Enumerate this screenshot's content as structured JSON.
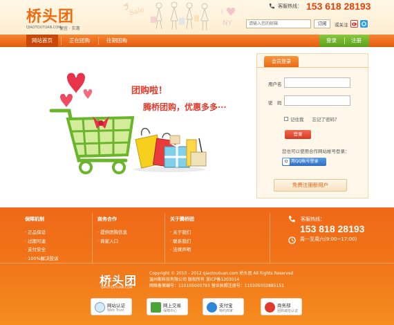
{
  "header": {
    "logo_text": "桥头团",
    "logo_domain": "QIAOTOUTUAN.COM",
    "logo_slogan": "便宜 · 实惠",
    "hotline_label": "客服热线：",
    "hotline_number": "153 618 28193",
    "subscribe_placeholder": "请输入您的邮箱",
    "subscribe_button": "订阅",
    "or_label": "或关注"
  },
  "nav": {
    "items": [
      {
        "label": "网站首页",
        "active": true
      },
      {
        "label": "正在团购",
        "active": false
      },
      {
        "label": "往期团购",
        "active": false
      }
    ],
    "login": "登录",
    "register": "注册"
  },
  "hero": {
    "line1": "团购啦！",
    "line2": "腾桥团购，优惠多多···"
  },
  "login_panel": {
    "title": "会员登录",
    "username_label": "用户名",
    "password_label": "密　码",
    "remember_label": "记住我",
    "forgot_label": "忘记了密码？",
    "login_button": "登录",
    "partner_text": "您也可以使用合作网站帐号登录：",
    "qq_button": "用QQ帐号登录",
    "register_button": "免费注册新用户"
  },
  "footer": {
    "columns": [
      {
        "title": "保障机制",
        "links": [
          "正品保证",
          "过期可退",
          "支付安全",
          "100%解决投诉"
        ]
      },
      {
        "title": "商务合作",
        "links": [
          "提供团购信息",
          "商家入口"
        ]
      },
      {
        "title": "关于腾桥团",
        "links": [
          "关于我们",
          "联系我们",
          "法律声明"
        ]
      }
    ],
    "hotline_label": "客服热线：",
    "hotline_number": "153 818 28193",
    "service_time": "周一至周六(9:00~17:00)",
    "logo_text": "桥头团",
    "logo_domain": "QIAOTOUTUAN.COM",
    "copyright": [
      "Copyright © 2010 - 2012 qiaotoutuan.com 桥头团 All Rights Reserved",
      "温州斯科技有限公司 版权所有 浙ICP备1203014",
      "网络备案编号：110105000793 营业执照注册号：110105002885151"
    ],
    "badges": [
      {
        "title": "网站认证",
        "sub": "Web Trust"
      },
      {
        "title": "网上交易",
        "sub": "保障中心"
      },
      {
        "title": "支付宝",
        "sub": "特约商家"
      },
      {
        "title": "商务部",
        "sub": "团购诚信认证"
      }
    ]
  },
  "colors": {
    "accent": "#f06a10",
    "nav": "#e35c10",
    "green": "#6ab02a",
    "red": "#e03a2c"
  }
}
